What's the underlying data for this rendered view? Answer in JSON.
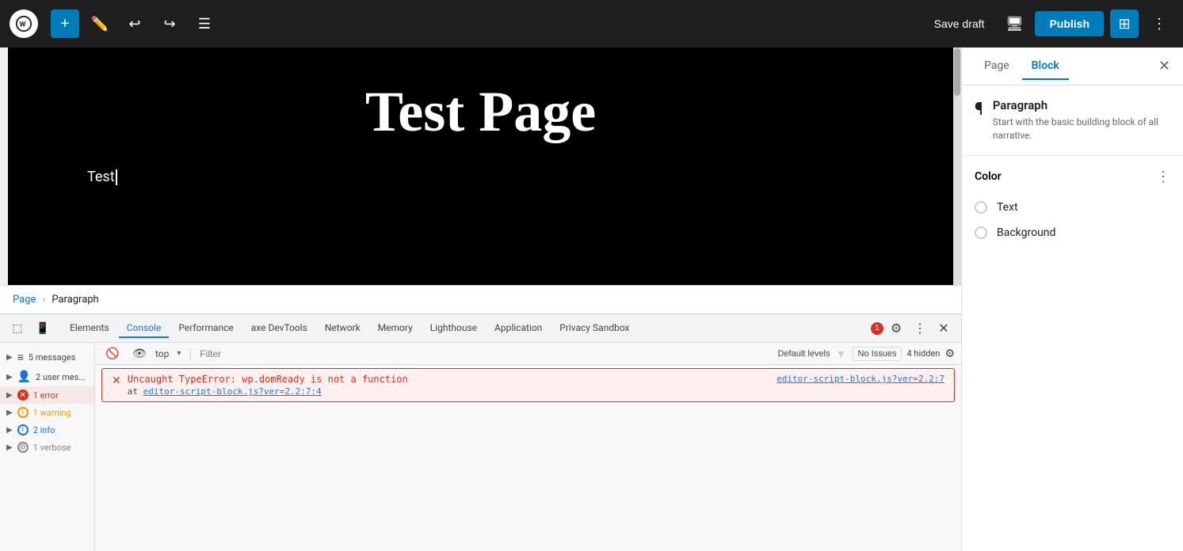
{
  "toolbar": {
    "add_label": "+",
    "save_draft_label": "Save draft",
    "publish_label": "Publish"
  },
  "breadcrumb": {
    "page_label": "Page",
    "separator": "›",
    "paragraph_label": "Paragraph"
  },
  "sidebar": {
    "page_tab": "Page",
    "block_tab": "Block",
    "block_name": "Paragraph",
    "block_desc": "Start with the basic building block of all narrative.",
    "color_section": "Color",
    "text_label": "Text",
    "background_label": "Background"
  },
  "canvas": {
    "page_title": "Test Page",
    "test_content": "Test"
  },
  "devtools": {
    "tabs": [
      "Elements",
      "Console",
      "Performance",
      "axe DevTools",
      "Network",
      "Memory",
      "Lighthouse",
      "Application",
      "Privacy Sandbox"
    ],
    "active_tab": "Console",
    "error_count": "1",
    "filter_placeholder": "Filter",
    "default_levels": "Default levels",
    "no_issues": "No Issues",
    "hidden_count": "4 hidden",
    "sidebar_items": [
      {
        "label": "5 messages",
        "type": "all"
      },
      {
        "label": "2 user mes...",
        "type": "user"
      },
      {
        "label": "1 error",
        "type": "error"
      },
      {
        "label": "1 warning",
        "type": "warning"
      },
      {
        "label": "2 info",
        "type": "info"
      },
      {
        "label": "1 verbose",
        "type": "verbose"
      }
    ],
    "error": {
      "main": "Uncaught TypeError: wp.domReady is not a function",
      "at_label": "at",
      "file": "editor-script-block.js?ver=2.2:7:4",
      "file_right": "editor-script-block.js?ver=2.2:7"
    },
    "top_context": "top"
  }
}
